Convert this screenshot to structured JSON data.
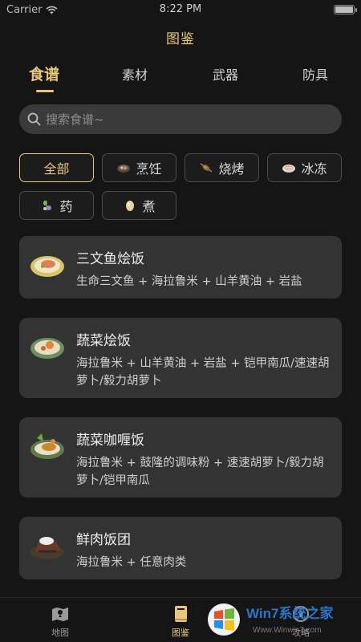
{
  "status": {
    "carrier": "Carrier",
    "time": "8:22 PM"
  },
  "nav": {
    "title": "图鉴"
  },
  "tabs": [
    {
      "label": "食谱",
      "active": true
    },
    {
      "label": "素材",
      "active": false
    },
    {
      "label": "武器",
      "active": false
    },
    {
      "label": "防具",
      "active": false
    }
  ],
  "search": {
    "placeholder": "搜索食谱~"
  },
  "filters": [
    {
      "label": "全部",
      "icon": "none",
      "active": true
    },
    {
      "label": "烹饪",
      "icon": "pot-icon",
      "active": false
    },
    {
      "label": "烧烤",
      "icon": "skewer-icon",
      "active": false
    },
    {
      "label": "冰冻",
      "icon": "frozen-food-icon",
      "active": false
    },
    {
      "label": "药",
      "icon": "herb-icon",
      "active": false
    },
    {
      "label": "煮",
      "icon": "egg-icon",
      "active": false
    }
  ],
  "recipes": [
    {
      "name": "三文鱼烩饭",
      "ingredients": "生命三文鱼 + 海拉鲁米 + 山羊黄油 + 岩盐",
      "thumb": "salmon-risotto-icon"
    },
    {
      "name": "蔬菜烩饭",
      "ingredients": "海拉鲁米 + 山羊黄油 + 岩盐 + 铠甲南瓜/速速胡萝卜/毅力胡萝卜",
      "thumb": "vegetable-risotto-icon"
    },
    {
      "name": "蔬菜咖喱饭",
      "ingredients": "海拉鲁米 + 鼓隆的调味粉 + 速速胡萝卜/毅力胡萝卜/铠甲南瓜",
      "thumb": "vegetable-curry-icon"
    },
    {
      "name": "鲜肉饭团",
      "ingredients": "海拉鲁米 + 任意肉类",
      "thumb": "meat-rice-ball-icon"
    }
  ],
  "tabbar": [
    {
      "label": "地图",
      "icon": "map-icon",
      "active": false
    },
    {
      "label": "图鉴",
      "icon": "book-icon",
      "active": true
    },
    {
      "label": "攻略",
      "icon": "guide-icon",
      "active": false
    }
  ],
  "watermark": {
    "text": "Win7系统之家",
    "url": "Www.Winwin7.com"
  },
  "colors": {
    "accent": "#e7c77e",
    "background": "#151515",
    "card": "#333333"
  }
}
